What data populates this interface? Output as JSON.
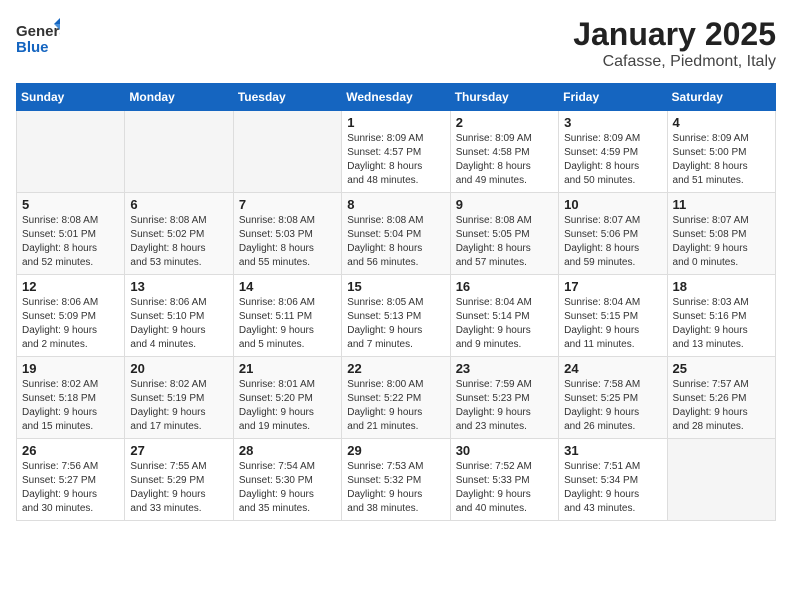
{
  "header": {
    "logo_general": "General",
    "logo_blue": "Blue",
    "month_title": "January 2025",
    "location": "Cafasse, Piedmont, Italy"
  },
  "calendar": {
    "days_of_week": [
      "Sunday",
      "Monday",
      "Tuesday",
      "Wednesday",
      "Thursday",
      "Friday",
      "Saturday"
    ],
    "weeks": [
      [
        {
          "day": "",
          "detail": ""
        },
        {
          "day": "",
          "detail": ""
        },
        {
          "day": "",
          "detail": ""
        },
        {
          "day": "1",
          "detail": "Sunrise: 8:09 AM\nSunset: 4:57 PM\nDaylight: 8 hours\nand 48 minutes."
        },
        {
          "day": "2",
          "detail": "Sunrise: 8:09 AM\nSunset: 4:58 PM\nDaylight: 8 hours\nand 49 minutes."
        },
        {
          "day": "3",
          "detail": "Sunrise: 8:09 AM\nSunset: 4:59 PM\nDaylight: 8 hours\nand 50 minutes."
        },
        {
          "day": "4",
          "detail": "Sunrise: 8:09 AM\nSunset: 5:00 PM\nDaylight: 8 hours\nand 51 minutes."
        }
      ],
      [
        {
          "day": "5",
          "detail": "Sunrise: 8:08 AM\nSunset: 5:01 PM\nDaylight: 8 hours\nand 52 minutes."
        },
        {
          "day": "6",
          "detail": "Sunrise: 8:08 AM\nSunset: 5:02 PM\nDaylight: 8 hours\nand 53 minutes."
        },
        {
          "day": "7",
          "detail": "Sunrise: 8:08 AM\nSunset: 5:03 PM\nDaylight: 8 hours\nand 55 minutes."
        },
        {
          "day": "8",
          "detail": "Sunrise: 8:08 AM\nSunset: 5:04 PM\nDaylight: 8 hours\nand 56 minutes."
        },
        {
          "day": "9",
          "detail": "Sunrise: 8:08 AM\nSunset: 5:05 PM\nDaylight: 8 hours\nand 57 minutes."
        },
        {
          "day": "10",
          "detail": "Sunrise: 8:07 AM\nSunset: 5:06 PM\nDaylight: 8 hours\nand 59 minutes."
        },
        {
          "day": "11",
          "detail": "Sunrise: 8:07 AM\nSunset: 5:08 PM\nDaylight: 9 hours\nand 0 minutes."
        }
      ],
      [
        {
          "day": "12",
          "detail": "Sunrise: 8:06 AM\nSunset: 5:09 PM\nDaylight: 9 hours\nand 2 minutes."
        },
        {
          "day": "13",
          "detail": "Sunrise: 8:06 AM\nSunset: 5:10 PM\nDaylight: 9 hours\nand 4 minutes."
        },
        {
          "day": "14",
          "detail": "Sunrise: 8:06 AM\nSunset: 5:11 PM\nDaylight: 9 hours\nand 5 minutes."
        },
        {
          "day": "15",
          "detail": "Sunrise: 8:05 AM\nSunset: 5:13 PM\nDaylight: 9 hours\nand 7 minutes."
        },
        {
          "day": "16",
          "detail": "Sunrise: 8:04 AM\nSunset: 5:14 PM\nDaylight: 9 hours\nand 9 minutes."
        },
        {
          "day": "17",
          "detail": "Sunrise: 8:04 AM\nSunset: 5:15 PM\nDaylight: 9 hours\nand 11 minutes."
        },
        {
          "day": "18",
          "detail": "Sunrise: 8:03 AM\nSunset: 5:16 PM\nDaylight: 9 hours\nand 13 minutes."
        }
      ],
      [
        {
          "day": "19",
          "detail": "Sunrise: 8:02 AM\nSunset: 5:18 PM\nDaylight: 9 hours\nand 15 minutes."
        },
        {
          "day": "20",
          "detail": "Sunrise: 8:02 AM\nSunset: 5:19 PM\nDaylight: 9 hours\nand 17 minutes."
        },
        {
          "day": "21",
          "detail": "Sunrise: 8:01 AM\nSunset: 5:20 PM\nDaylight: 9 hours\nand 19 minutes."
        },
        {
          "day": "22",
          "detail": "Sunrise: 8:00 AM\nSunset: 5:22 PM\nDaylight: 9 hours\nand 21 minutes."
        },
        {
          "day": "23",
          "detail": "Sunrise: 7:59 AM\nSunset: 5:23 PM\nDaylight: 9 hours\nand 23 minutes."
        },
        {
          "day": "24",
          "detail": "Sunrise: 7:58 AM\nSunset: 5:25 PM\nDaylight: 9 hours\nand 26 minutes."
        },
        {
          "day": "25",
          "detail": "Sunrise: 7:57 AM\nSunset: 5:26 PM\nDaylight: 9 hours\nand 28 minutes."
        }
      ],
      [
        {
          "day": "26",
          "detail": "Sunrise: 7:56 AM\nSunset: 5:27 PM\nDaylight: 9 hours\nand 30 minutes."
        },
        {
          "day": "27",
          "detail": "Sunrise: 7:55 AM\nSunset: 5:29 PM\nDaylight: 9 hours\nand 33 minutes."
        },
        {
          "day": "28",
          "detail": "Sunrise: 7:54 AM\nSunset: 5:30 PM\nDaylight: 9 hours\nand 35 minutes."
        },
        {
          "day": "29",
          "detail": "Sunrise: 7:53 AM\nSunset: 5:32 PM\nDaylight: 9 hours\nand 38 minutes."
        },
        {
          "day": "30",
          "detail": "Sunrise: 7:52 AM\nSunset: 5:33 PM\nDaylight: 9 hours\nand 40 minutes."
        },
        {
          "day": "31",
          "detail": "Sunrise: 7:51 AM\nSunset: 5:34 PM\nDaylight: 9 hours\nand 43 minutes."
        },
        {
          "day": "",
          "detail": ""
        }
      ]
    ]
  }
}
